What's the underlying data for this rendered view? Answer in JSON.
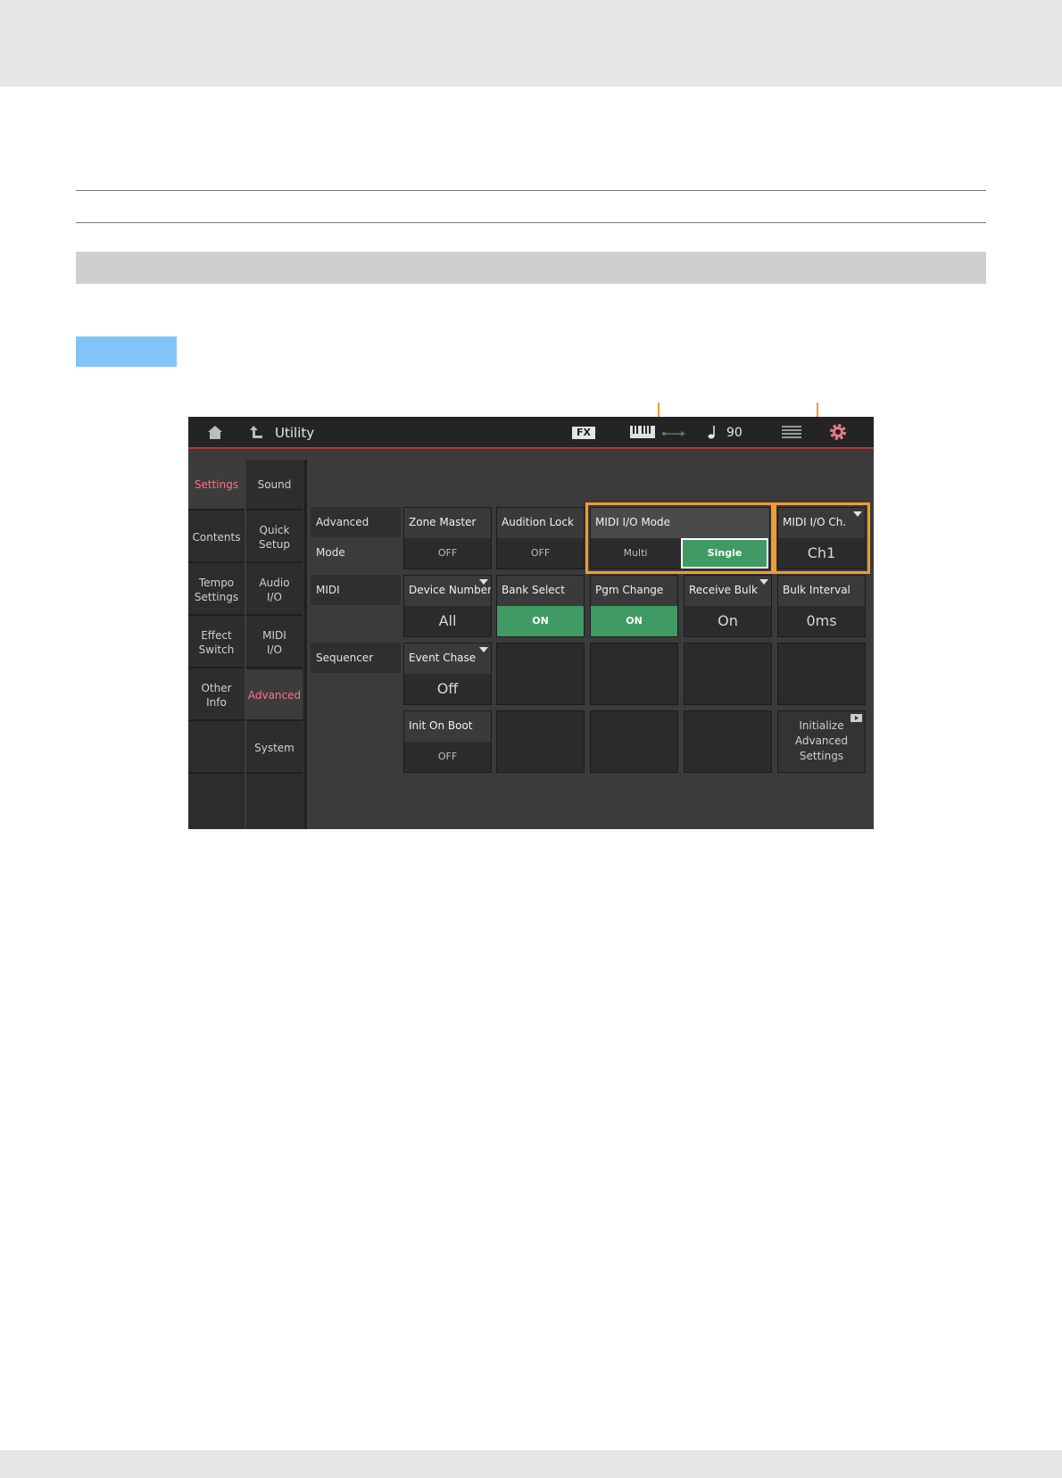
{
  "titlebar": {
    "home_icon": "home-icon",
    "back_icon": "back-arrow-icon",
    "title": "Utility",
    "fx_label": "FX",
    "keyboard_icon": "keyboard-icon",
    "usb_icon": "usb-icon",
    "tempo_icon": "quarter-note-icon",
    "tempo": "90",
    "grid_icon": "grid-icon",
    "settings_icon": "gear-icon"
  },
  "sidebar": {
    "left": [
      {
        "label": "Settings",
        "active": true
      },
      {
        "label": "Contents"
      },
      {
        "label": "Tempo\nSettings"
      },
      {
        "label": "Effect\nSwitch"
      },
      {
        "label": "Other\nInfo"
      },
      {
        "label": ""
      },
      {
        "label": ""
      }
    ],
    "right": [
      {
        "label": "Sound"
      },
      {
        "label": "Quick\nSetup"
      },
      {
        "label": "Audio\nI/O"
      },
      {
        "label": "MIDI\nI/O"
      },
      {
        "label": "Advanced",
        "active": true
      },
      {
        "label": "System"
      },
      {
        "label": ""
      }
    ]
  },
  "sections": {
    "advanced_mode": "Advanced Mode",
    "midi": "MIDI",
    "sequencer": "Sequencer"
  },
  "params": {
    "zone_master": {
      "title": "Zone Master",
      "value": "OFF"
    },
    "audition_lock": {
      "title": "Audition Lock",
      "value": "OFF"
    },
    "midi_io_mode": {
      "title": "MIDI I/O Mode",
      "options": [
        "Multi",
        "Single"
      ],
      "selected": "Single"
    },
    "midi_io_ch": {
      "title": "MIDI I/O Ch.",
      "value": "Ch1"
    },
    "device_number": {
      "title": "Device Number",
      "value": "All"
    },
    "bank_select": {
      "title": "Bank Select",
      "value": "ON"
    },
    "pgm_change": {
      "title": "Pgm Change",
      "value": "ON"
    },
    "receive_bulk": {
      "title": "Receive Bulk",
      "value": "On"
    },
    "bulk_interval": {
      "title": "Bulk Interval",
      "value": "0ms"
    },
    "event_chase": {
      "title": "Event Chase",
      "value": "Off"
    },
    "init_on_boot": {
      "title": "Init On Boot",
      "value": "OFF"
    },
    "initialize_advanced": {
      "label": "Initialize\nAdvanced\nSettings"
    }
  },
  "colors": {
    "accent_pink": "#ff6f8a",
    "on_green": "#3f9a63",
    "callout_orange": "#f39a2e",
    "title_red_line": "#b3363e"
  }
}
